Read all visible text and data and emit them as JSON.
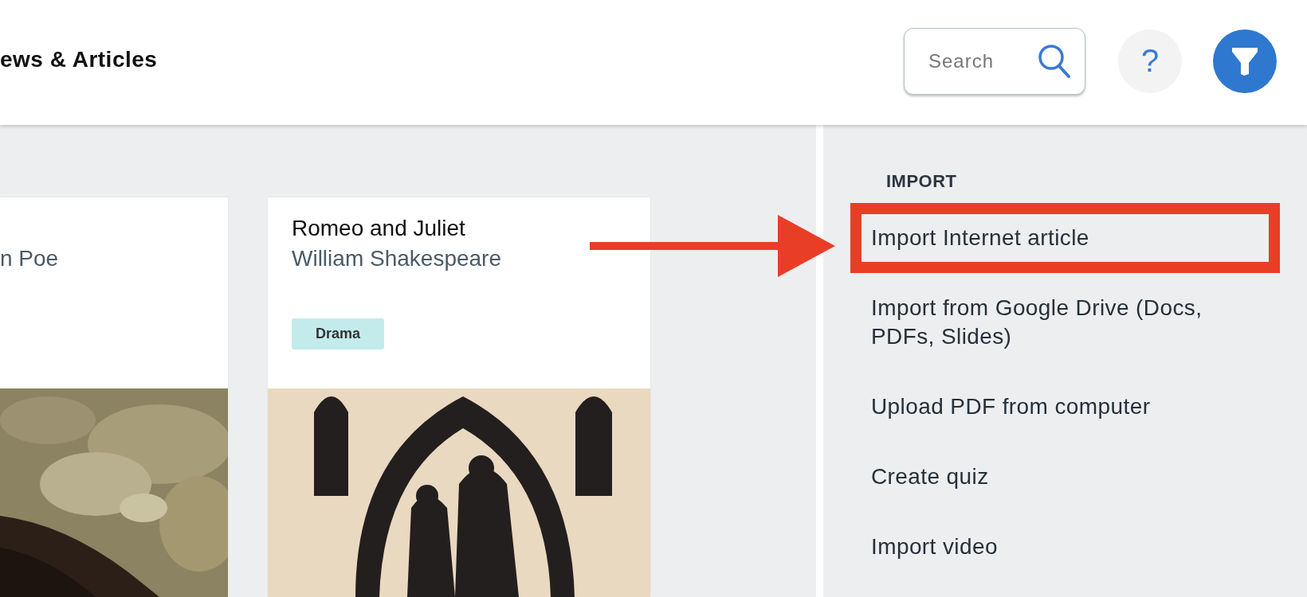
{
  "header": {
    "title": "ews & Articles",
    "search": {
      "placeholder": "Search"
    },
    "help_button": "?"
  },
  "cards": [
    {
      "author": "n Poe"
    },
    {
      "title": "Romeo and Juliet",
      "author": "William Shakespeare",
      "tag": "Drama"
    }
  ],
  "import_panel": {
    "heading": "IMPORT",
    "items": [
      {
        "label": "Import Internet article",
        "highlighted": true
      },
      {
        "label": "Import from Google Drive (Docs, PDFs, Slides)",
        "highlighted": false
      },
      {
        "label": "Upload PDF from computer",
        "highlighted": false
      },
      {
        "label": "Create quiz",
        "highlighted": false
      },
      {
        "label": "Import video",
        "highlighted": false
      }
    ]
  }
}
